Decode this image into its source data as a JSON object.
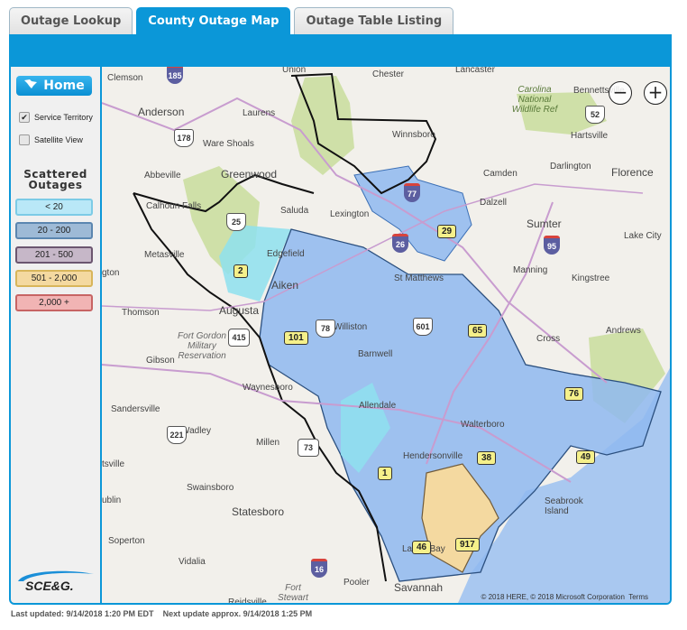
{
  "tabs": [
    {
      "label": "Outage Lookup",
      "active": false
    },
    {
      "label": "County Outage Map",
      "active": true
    },
    {
      "label": "Outage Table Listing",
      "active": false
    }
  ],
  "sidebar": {
    "home_label": "Home",
    "service_territory": {
      "label": "Service Territory",
      "checked": true
    },
    "satellite_view": {
      "label": "Satellite View",
      "checked": false
    },
    "legend_title_line1": "Scattered",
    "legend_title_line2": "Outages",
    "legend": [
      {
        "label": "< 20",
        "fill": "#b9e8f7",
        "border": "#7ccbe6"
      },
      {
        "label": "20 - 200",
        "fill": "#9ebad6",
        "border": "#5b86b0"
      },
      {
        "label": "201 - 500",
        "fill": "#c6b7c8",
        "border": "#6b5670"
      },
      {
        "label": "501 - 2,000",
        "fill": "#f4d9a0",
        "border": "#d8b55a"
      },
      {
        "label": "2,000 +",
        "fill": "#f1b4b4",
        "border": "#c76464"
      }
    ],
    "logo_text": "SCE&G."
  },
  "map": {
    "zoom_out": "−",
    "zoom_in": "+",
    "attribution": "© 2018 HERE, © 2018 Microsoft Corporation",
    "terms": "Terms",
    "places": [
      {
        "name": "Clemson"
      },
      {
        "name": "Union"
      },
      {
        "name": "Chester"
      },
      {
        "name": "Lancaster"
      },
      {
        "name": "Anderson"
      },
      {
        "name": "Laurens"
      },
      {
        "name": "Ware Shoals"
      },
      {
        "name": "Winnsboro"
      },
      {
        "name": "Hartsville"
      },
      {
        "name": "Abbeville"
      },
      {
        "name": "Greenwood"
      },
      {
        "name": "Darlington"
      },
      {
        "name": "Florence"
      },
      {
        "name": "Camden"
      },
      {
        "name": "Calhoun Falls"
      },
      {
        "name": "Saluda"
      },
      {
        "name": "Lexington"
      },
      {
        "name": "Dalzell"
      },
      {
        "name": "Sumter"
      },
      {
        "name": "Lake City"
      },
      {
        "name": "Edgefield"
      },
      {
        "name": "Metasville"
      },
      {
        "name": "Manning"
      },
      {
        "name": "St Matthews"
      },
      {
        "name": "Kingstree"
      },
      {
        "name": "Aiken"
      },
      {
        "name": "Augusta"
      },
      {
        "name": "Thomson"
      },
      {
        "name": "Williston"
      },
      {
        "name": "Andrews"
      },
      {
        "name": "Cross"
      },
      {
        "name": "Gibson"
      },
      {
        "name": "Barnwell"
      },
      {
        "name": "Waynesboro"
      },
      {
        "name": "Sandersville"
      },
      {
        "name": "Allendale"
      },
      {
        "name": "Walterboro"
      },
      {
        "name": "Wadley"
      },
      {
        "name": "Millen"
      },
      {
        "name": "Hendersonville"
      },
      {
        "name": "Swainsboro"
      },
      {
        "name": "Seabrook Island"
      },
      {
        "name": "Statesboro"
      },
      {
        "name": "Laurel Bay"
      },
      {
        "name": "Soperton"
      },
      {
        "name": "Vidalia"
      },
      {
        "name": "Pooler"
      },
      {
        "name": "Savannah"
      },
      {
        "name": "Reidsville"
      },
      {
        "name": "Bennettsville"
      },
      {
        "name": "gton"
      },
      {
        "name": "tsville"
      },
      {
        "name": "ublin"
      }
    ],
    "parks": [
      {
        "name": "Carolina National Wildlife Ref"
      },
      {
        "name": "Fort Gordon Military Reservation"
      },
      {
        "name": "Fort Stewart"
      }
    ],
    "highways": [
      "185",
      "178",
      "25",
      "77",
      "26",
      "95",
      "52",
      "78",
      "415",
      "601",
      "221",
      "73",
      "16"
    ],
    "outage_counts": [
      {
        "value": "29"
      },
      {
        "value": "2"
      },
      {
        "value": "101"
      },
      {
        "value": "65"
      },
      {
        "value": "76"
      },
      {
        "value": "38"
      },
      {
        "value": "49"
      },
      {
        "value": "1"
      },
      {
        "value": "46"
      },
      {
        "value": "917"
      }
    ]
  },
  "footer": {
    "last_updated": "Last updated: 9/14/2018 1:20 PM EDT",
    "next_update": "Next update approx. 9/14/2018 1:25 PM"
  }
}
